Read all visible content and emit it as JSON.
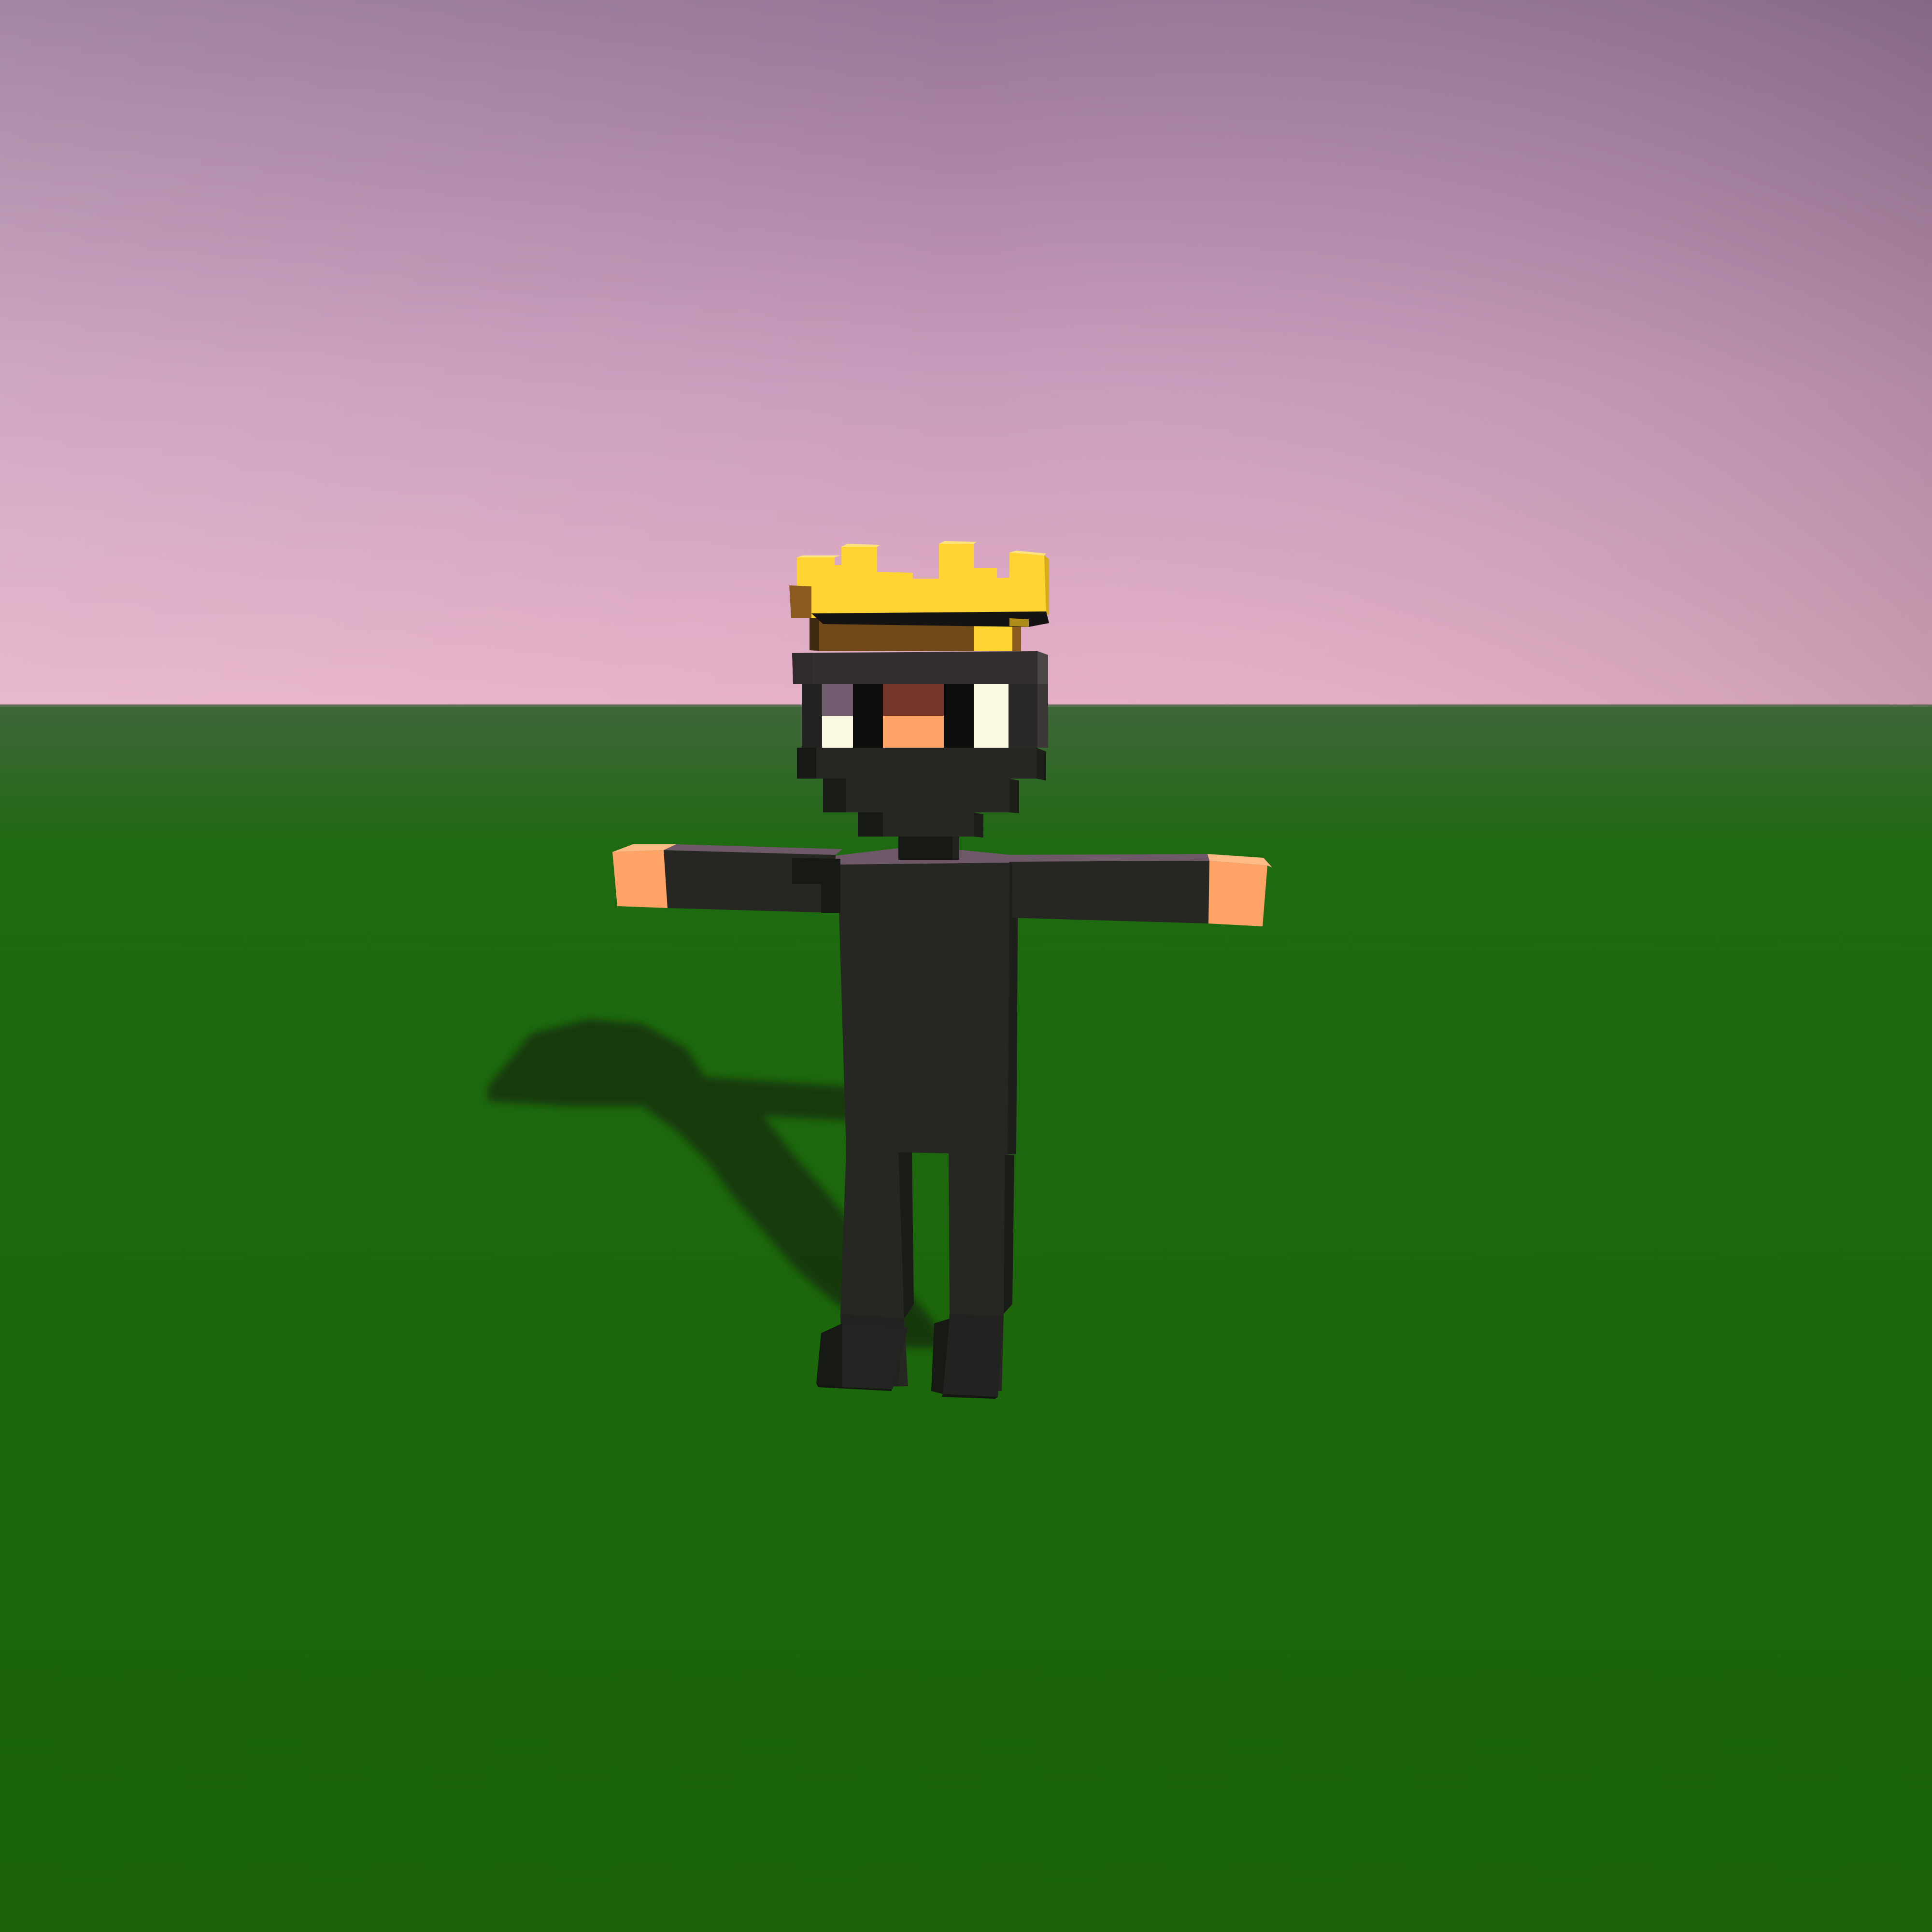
{
  "scene": {
    "description_hidden": "",
    "sky": {
      "top_color": "#977596",
      "mid_color": "#c99cbc",
      "horizon_left_color": "#e6b0c6",
      "horizon_right_color": "#b98ea4"
    },
    "ground": {
      "near_horizon_color": "#3f663a",
      "mid_color": "#1e6a10",
      "far_color": "#1a6307"
    },
    "shadow_color": "#16310d",
    "character": {
      "name": "",
      "pose": "t-pose",
      "palette": {
        "crown_gold": "#ffd432",
        "crown_gold_dark": "#d6ab1c",
        "crown_band": "#6f4a18",
        "crown_band_side": "#8a5a1e",
        "mask": "#2c2a28",
        "mask_dark": "#1d1c1a",
        "mask_side": "#3b3837",
        "eye_white": "#fbf8e2",
        "eye_shadow": "#705c6e",
        "eye_pupil": "#0d0d0c",
        "nose_top": "#74352a",
        "skin": "#ffa367",
        "body": "#262622",
        "body_dark": "#171914",
        "shoulder_top": "#6e5968",
        "hand": "#ffa367"
      }
    }
  }
}
